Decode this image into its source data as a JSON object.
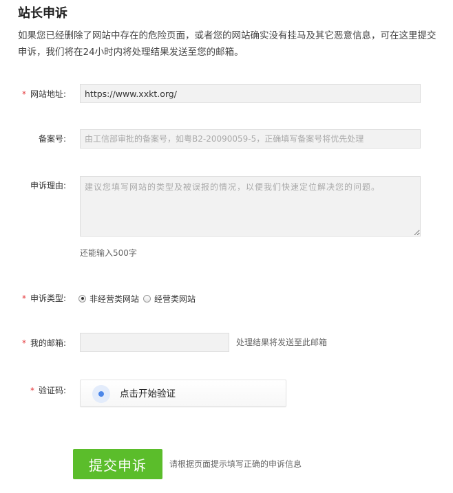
{
  "page": {
    "title": "站长申诉",
    "intro": "如果您已经删除了网站中存在的危险页面，或者您的网站确实没有挂马及其它恶意信息，可在这里提交申诉，我们将在24小时内将处理结果发送至您的邮箱。"
  },
  "form": {
    "required_mark": "*",
    "site_url": {
      "label": "网站地址:",
      "value": "https://www.xxkt.org/"
    },
    "icp": {
      "label": "备案号:",
      "placeholder": "由工信部审批的备案号，如粤B2-20090059-5，正确填写备案号将优先处理"
    },
    "reason": {
      "label": "申诉理由:",
      "placeholder": "建议您填写网站的类型及被误报的情况，以便我们快速定位解决您的问题。",
      "char_hint": "还能输入500字"
    },
    "appeal_type": {
      "label": "申诉类型:",
      "options": [
        {
          "label": "非经营类网站",
          "checked": true
        },
        {
          "label": "经营类网站",
          "checked": false
        }
      ]
    },
    "email": {
      "label": "我的邮箱:",
      "value": "",
      "hint": "处理结果将发送至此邮箱"
    },
    "captcha": {
      "label": "验证码:",
      "button_text": "点击开始验证",
      "icon": "verify-dot-icon"
    },
    "submit": {
      "label": "提交申诉",
      "hint": "请根据页面提示填写正确的申诉信息"
    }
  },
  "colors": {
    "accent_green": "#5bbd2b",
    "required_red": "#e4393c",
    "captcha_blue": "#4b86e8"
  }
}
